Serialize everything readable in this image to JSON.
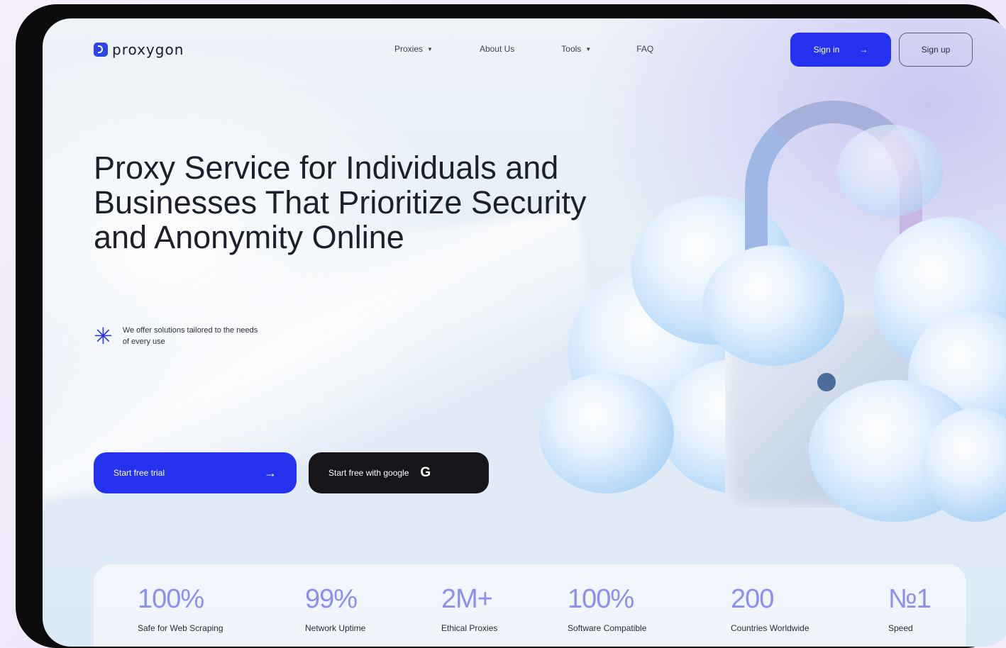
{
  "brand": {
    "name": "proxygon",
    "accent": "#2432f0"
  },
  "nav": {
    "items": [
      {
        "label": "Proxies",
        "has_dropdown": true
      },
      {
        "label": "About Us",
        "has_dropdown": false
      },
      {
        "label": "Tools",
        "has_dropdown": true
      },
      {
        "label": "FAQ",
        "has_dropdown": false
      }
    ],
    "signin_label": "Sign in",
    "signup_label": "Sign up"
  },
  "hero": {
    "title": "Proxy Service for Individuals and Businesses That Prioritize Security and Anonymity Online",
    "offer_text": "We offer solutions tailored to the needs of every use",
    "trial_label": "Start free trial",
    "google_label": "Start free with google"
  },
  "stats": [
    {
      "value": "100%",
      "label": "Safe for Web Scraping"
    },
    {
      "value": "99%",
      "label": "Network Uptime"
    },
    {
      "value": "2M+",
      "label": "Ethical Proxies"
    },
    {
      "value": "100%",
      "label": "Software Compatible"
    },
    {
      "value": "200",
      "label": "Countries Worldwide"
    },
    {
      "value": "№1",
      "label": "Speed"
    }
  ],
  "icons": [
    "logo-mark-icon",
    "chevron-down-icon",
    "arrow-right-icon",
    "asterisk-icon",
    "google-icon",
    "lock-illustration"
  ]
}
